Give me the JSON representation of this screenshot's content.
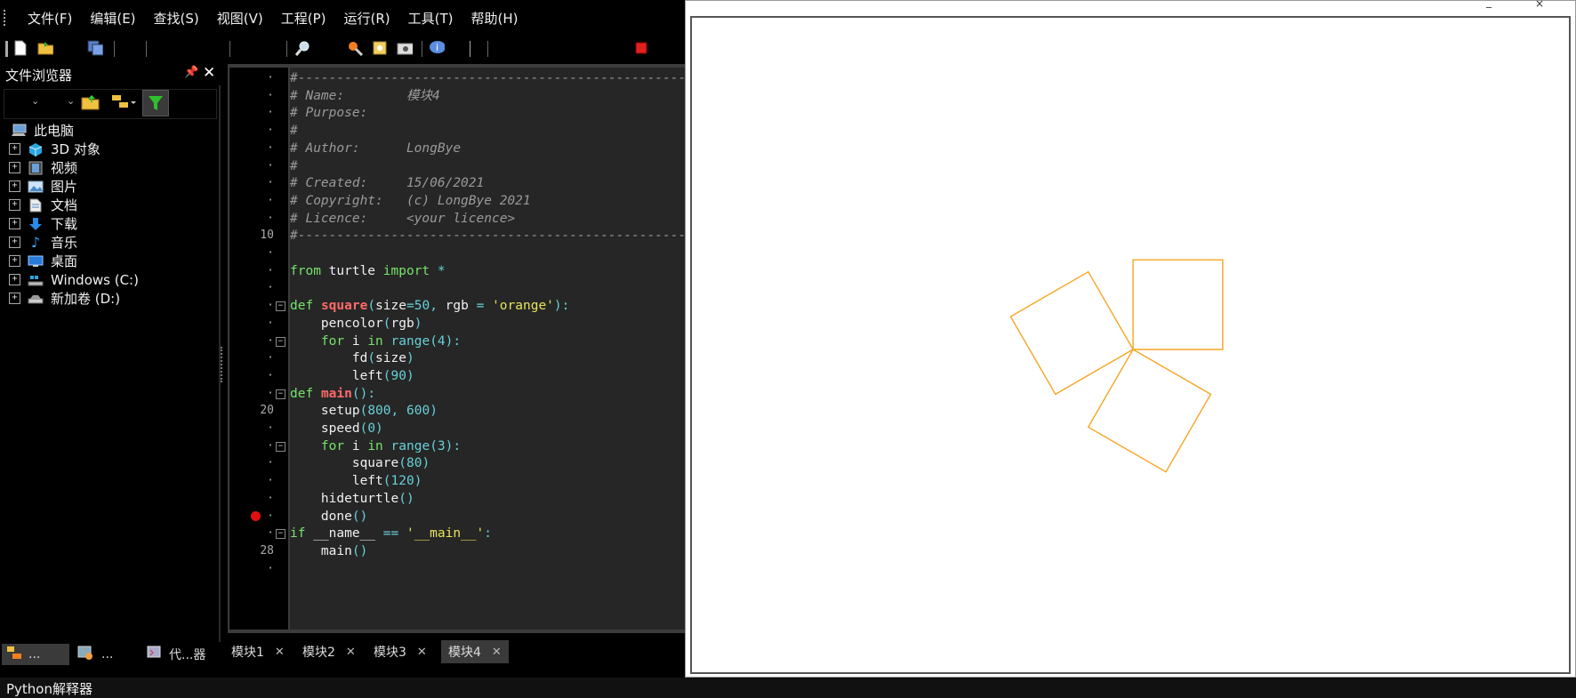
{
  "menu": [
    "文件(F)",
    "编辑(E)",
    "查找(S)",
    "视图(V)",
    "工程(P)",
    "运行(R)",
    "工具(T)",
    "帮助(H)"
  ],
  "file_browser": {
    "title": "文件浏览器",
    "root": "此电脑",
    "items": [
      "3D 对象",
      "视频",
      "图片",
      "文档",
      "下载",
      "音乐",
      "桌面",
      "Windows (C:)",
      "新加卷 (D:)"
    ]
  },
  "bottom_tabs": [
    "...",
    "...",
    "代...器"
  ],
  "editor": {
    "line_numbers": {
      "10": "10",
      "20": "20",
      "28": "28"
    },
    "tabs": [
      "模块1",
      "模块2",
      "模块3",
      "模块4"
    ],
    "active_tab": "模块4"
  },
  "code": [
    "#----------------------------------------------------------------",
    "# Name:        模块4",
    "# Purpose:",
    "#",
    "# Author:      LongBye",
    "#",
    "# Created:     15/06/2021",
    "# Copyright:   (c) LongBye 2021",
    "# Licence:     <your licence>",
    "#----------------------------------------------------------------",
    "",
    "from turtle import *",
    "",
    "def square(size=50, rgb = 'orange'):",
    "    pencolor(rgb)",
    "    for i in range(4):",
    "        fd(size)",
    "        left(90)",
    "def main():",
    "    setup(800, 600)",
    "    speed(0)",
    "    for i in range(3):",
    "        square(80)",
    "        left(120)",
    "    hideturtle()",
    "    done()",
    "if __name__ == '__main__':",
    "    main()"
  ],
  "turtle": {
    "stroke_color": "#f5a623",
    "square_size": 80,
    "turn_angle": 120,
    "count": 3
  },
  "status": "Python解释器",
  "colors": {
    "breakpoint": "#e01010",
    "toolbar_stop": "#e02020"
  }
}
